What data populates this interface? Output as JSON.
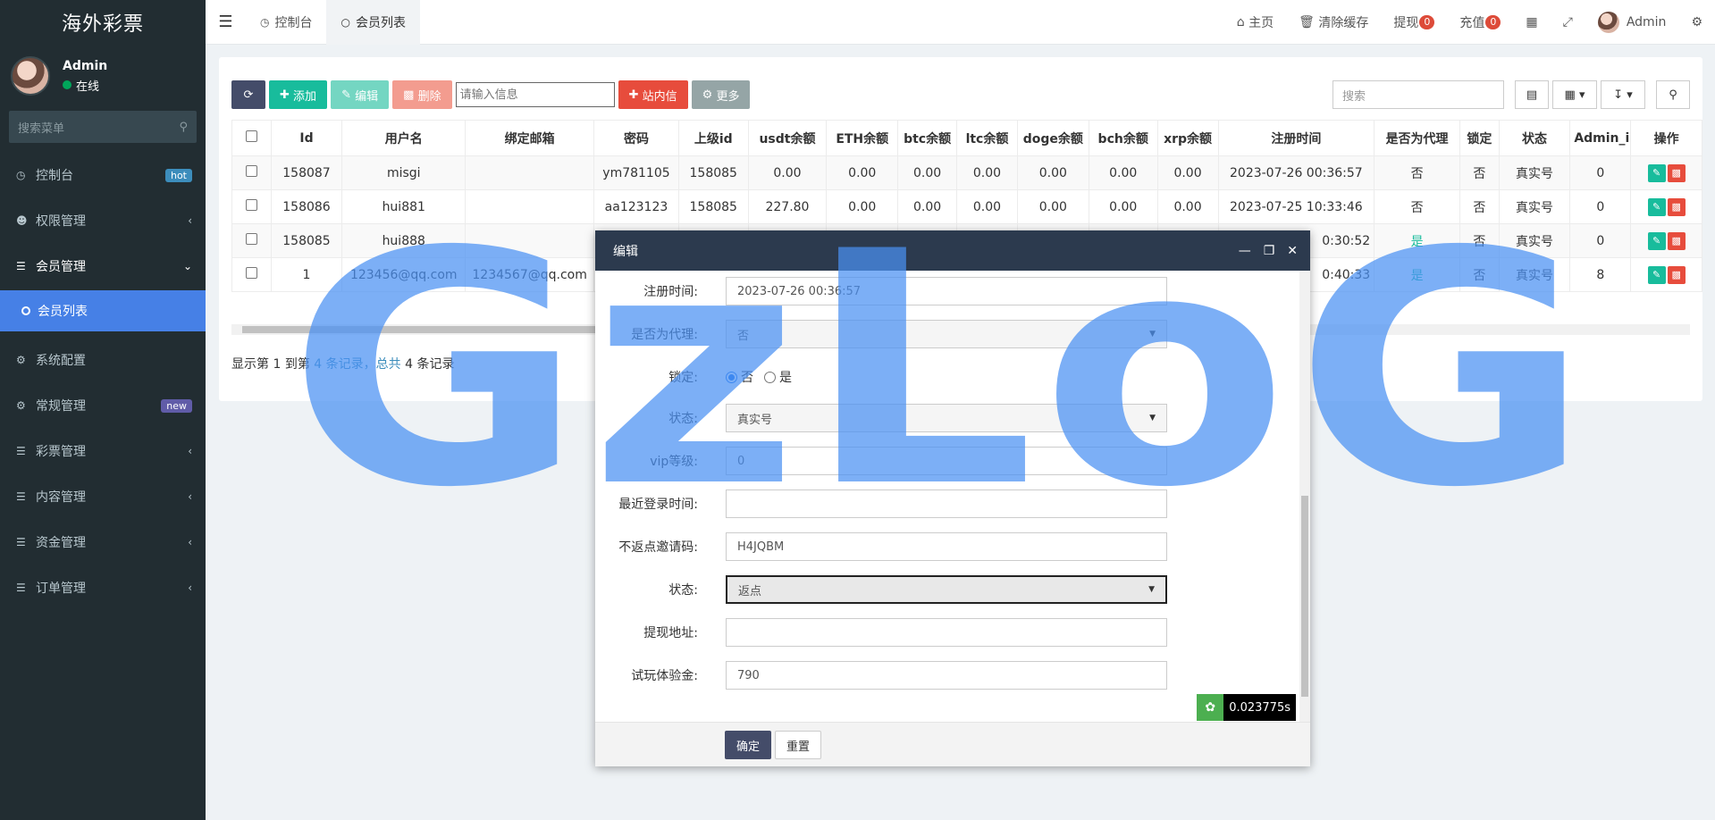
{
  "app": {
    "title": "海外彩票"
  },
  "user": {
    "name": "Admin",
    "status": "在线"
  },
  "sidebar": {
    "search_placeholder": "搜索菜单",
    "items": [
      {
        "label": "控制台",
        "badge": "hot"
      },
      {
        "label": "权限管理"
      },
      {
        "label": "会员管理"
      },
      {
        "label": "会员列表"
      },
      {
        "label": "系统配置"
      },
      {
        "label": "常规管理",
        "badge": "new"
      },
      {
        "label": "彩票管理"
      },
      {
        "label": "内容管理"
      },
      {
        "label": "资金管理"
      },
      {
        "label": "订单管理"
      }
    ]
  },
  "topbar": {
    "tabs": [
      {
        "label": "控制台"
      },
      {
        "label": "会员列表"
      }
    ],
    "home": "主页",
    "clear_cache": "清除缓存",
    "withdraw": "提现",
    "withdraw_count": "0",
    "recharge": "充值",
    "recharge_count": "0",
    "admin": "Admin"
  },
  "toolbar": {
    "add": "添加",
    "edit": "编辑",
    "delete": "删除",
    "input_placeholder": "请输入信息",
    "message": "站内信",
    "more": "更多",
    "search_placeholder": "搜索"
  },
  "table": {
    "columns": [
      "Id",
      "用户名",
      "绑定邮箱",
      "密码",
      "上级id",
      "usdt余额",
      "ETH余额",
      "btc余额",
      "ltc余额",
      "doge余额",
      "bch余额",
      "xrp余额",
      "注册时间",
      "是否为代理",
      "锁定",
      "状态",
      "Admin_id",
      "操作"
    ],
    "rows": [
      [
        "158087",
        "misgi",
        "",
        "ym781105",
        "158085",
        "0.00",
        "0.00",
        "0.00",
        "0.00",
        "0.00",
        "0.00",
        "0.00",
        "2023-07-26 00:36:57",
        "否",
        "否",
        "真实号",
        "0"
      ],
      [
        "158086",
        "hui881",
        "",
        "aa123123",
        "158085",
        "227.80",
        "0.00",
        "0.00",
        "0.00",
        "0.00",
        "0.00",
        "0.00",
        "2023-07-25 10:33:46",
        "否",
        "否",
        "真实号",
        "0"
      ],
      [
        "158085",
        "hui888",
        "",
        "",
        "",
        "",
        "",
        "",
        "",
        "",
        "",
        "",
        "0:30:52",
        "是",
        "否",
        "真实号",
        "0"
      ],
      [
        "1",
        "123456@qq.com",
        "1234567@qq.com",
        "",
        "",
        "",
        "",
        "",
        "",
        "",
        "",
        "",
        "0:40:33",
        "是",
        "否",
        "真实号",
        "8"
      ]
    ]
  },
  "pager": {
    "prefix": "显示第 ",
    "from": "1",
    "mid1": " 到第 ",
    "to": "4",
    "mid2": " 条记录，总共 ",
    "total": "4",
    "suffix": " 条记录"
  },
  "watermark": "GzLoG",
  "modal": {
    "title": "编辑",
    "fields": {
      "reg_time_label": "注册时间:",
      "reg_time": "2023-07-26 00:36:57",
      "agent_label": "是否为代理:",
      "agent": "否",
      "lock_label": "锁定:",
      "lock_no": "否",
      "lock_yes": "是",
      "status_label": "状态:",
      "status": "真实号",
      "vip_label": "vip等级:",
      "vip": "0",
      "last_login_label": "最近登录时间:",
      "last_login": "",
      "invite_label": "不返点邀请码:",
      "invite": "H4JQBM",
      "rebate_label": "状态:",
      "rebate": "返点",
      "addr_label": "提现地址:",
      "addr": "",
      "trial_label": "试玩体验金:",
      "trial": "790"
    },
    "timer": "0.023775s",
    "ok": "确定",
    "reset": "重置"
  }
}
